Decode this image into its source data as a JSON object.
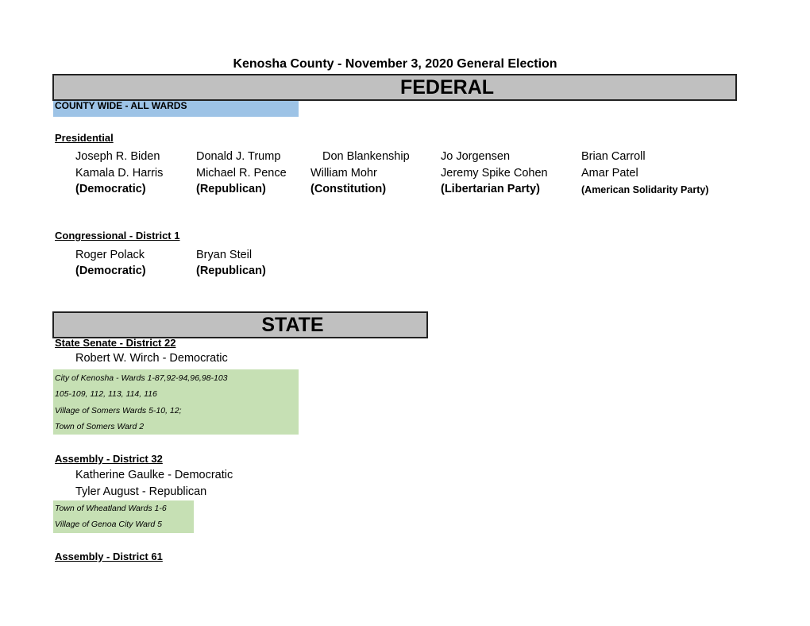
{
  "document": {
    "title": "Kenosha County - November 3, 2020 General Election"
  },
  "federal": {
    "band_label": "FEDERAL",
    "scope_label": "COUNTY WIDE - ALL WARDS",
    "presidential": {
      "heading": "Presidential",
      "tickets": [
        {
          "president": "Joseph R. Biden",
          "vice_president": "Kamala D. Harris",
          "party": "(Democratic)"
        },
        {
          "president": "Donald J. Trump",
          "vice_president": "Michael R. Pence",
          "party": "(Republican)"
        },
        {
          "president": "Don Blankenship",
          "vice_president": "William Mohr",
          "party": "(Constitution)"
        },
        {
          "president": "Jo Jorgensen",
          "vice_president": "Jeremy Spike Cohen",
          "party": "(Libertarian Party)"
        },
        {
          "president": "Brian Carroll",
          "vice_president": "Amar Patel",
          "party": "(American Solidarity Party)"
        }
      ]
    },
    "congressional": {
      "heading": "Congressional - District 1",
      "candidates": [
        {
          "name": "Roger Polack",
          "party": "(Democratic)"
        },
        {
          "name": "Bryan Steil",
          "party": "(Republican)"
        }
      ]
    }
  },
  "state": {
    "band_label": "STATE",
    "senate": {
      "heading": "State Senate - District 22",
      "candidates": [
        "Robert W. Wirch - Democratic"
      ],
      "wards": [
        "City of Kenosha - Wards 1-87,92-94,96,98-103",
        "105-109, 112, 113, 114, 116",
        "Village of Somers Wards 5-10, 12;",
        "Town of Somers Ward 2"
      ]
    },
    "assembly_32": {
      "heading": "Assembly - District 32",
      "candidates": [
        "Katherine Gaulke - Democratic",
        "Tyler August - Republican"
      ],
      "wards": [
        "Town of Wheatland Wards 1-6",
        "Village of Genoa City Ward 5"
      ]
    },
    "assembly_61": {
      "heading": "Assembly - District 61"
    }
  }
}
